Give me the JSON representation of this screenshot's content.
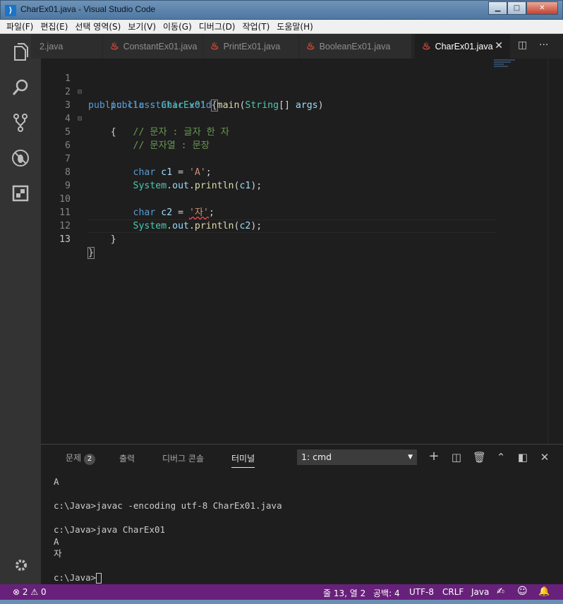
{
  "window": {
    "title": "CharEx01.java - Visual Studio Code",
    "buttons": [
      "minimize",
      "maximize",
      "close"
    ]
  },
  "menubar": {
    "items": [
      "파일(F)",
      "편집(E)",
      "선택 영역(S)",
      "보기(V)",
      "이동(G)",
      "디버그(D)",
      "작업(T)",
      "도움말(H)"
    ]
  },
  "activity_bar": {
    "icons": [
      "explorer-icon",
      "search-icon",
      "source-control-icon",
      "debug-icon",
      "extensions-icon",
      "settings-gear-icon"
    ]
  },
  "tabs": [
    {
      "label": "2.java",
      "active": false
    },
    {
      "label": "ConstantEx01.java",
      "active": false
    },
    {
      "label": "PrintEx01.java",
      "active": false
    },
    {
      "label": "BooleanEx01.java",
      "active": false
    },
    {
      "label": "CharEx01.java",
      "active": true
    }
  ],
  "tab_close_glyph": "✕",
  "editor": {
    "line_numbers": [
      "1",
      "2",
      "3",
      "4",
      "5",
      "6",
      "7",
      "8",
      "9",
      "10",
      "11",
      "12",
      "13"
    ],
    "current_line": 13,
    "code": {
      "l1": {
        "kw1": "public",
        "kw2": "class",
        "cls": "CharEx01",
        "brace": "{"
      },
      "l2": {
        "kw1": "public",
        "kw2": "static",
        "kw3": "void",
        "fn": "main",
        "type": "String",
        "rest": "[] ",
        "arg": "args",
        "close": ")"
      },
      "l3": {
        "brace": "{"
      },
      "l4": {
        "comment": "// 문자 : 글자 한 자"
      },
      "l5": {
        "comment": "// 문자열 : 문장"
      },
      "l7": {
        "kw": "char",
        "var": "c1",
        "op": " = ",
        "str": "'A'",
        "semi": ";"
      },
      "l8": {
        "obj": "System",
        "field": "out",
        "fn": "println",
        "arg": "c1",
        "tail": ");"
      },
      "l10": {
        "kw": "char",
        "var": "c2",
        "op": " = ",
        "str": "'자'",
        "semi": ";"
      },
      "l11": {
        "obj": "System",
        "field": "out",
        "fn": "println",
        "arg": "c2",
        "tail": ");"
      },
      "l12": {
        "brace": "}"
      },
      "l13": {
        "brace": "}"
      }
    }
  },
  "panel": {
    "tabs": [
      {
        "label": "문제",
        "badge": "2"
      },
      {
        "label": "출력"
      },
      {
        "label": "디버그 콘솔"
      },
      {
        "label": "터미널",
        "active": true
      }
    ],
    "terminal_select": "1: cmd",
    "terminal_lines": [
      "A",
      "",
      "c:\\Java>javac -encoding utf-8 CharEx01.java",
      "",
      "c:\\Java>java CharEx01",
      "A",
      "자",
      "",
      "c:\\Java>"
    ]
  },
  "statusbar": {
    "errors": "2",
    "warnings": "0",
    "position": "줄 13, 열 2",
    "spaces": "공백: 4",
    "encoding": "UTF-8",
    "eol": "CRLF",
    "language": "Java",
    "color": "#68217a"
  }
}
